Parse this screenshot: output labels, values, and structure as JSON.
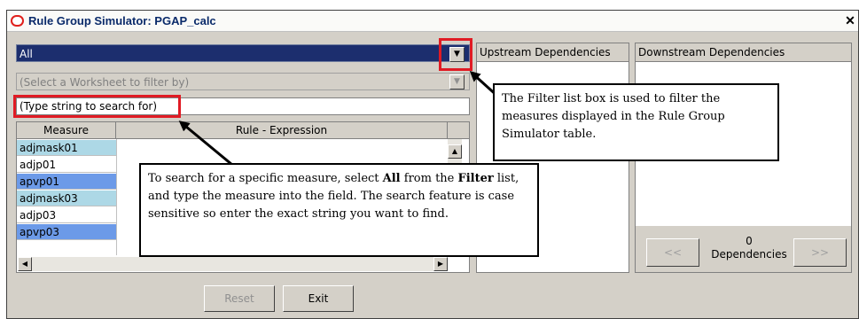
{
  "window": {
    "title": "Rule Group Simulator: PGAP_calc",
    "close_glyph": "✕"
  },
  "filter": {
    "value": "All",
    "dropdown_glyph": "▼"
  },
  "worksheet_filter": {
    "placeholder": "(Select a Worksheet to filter by)",
    "dropdown_glyph": "▼"
  },
  "search": {
    "placeholder": "(Type string to search for)"
  },
  "grid": {
    "columns": [
      "Measure",
      "Rule - Expression"
    ],
    "rows": [
      {
        "measure": "adjmask01",
        "color": "#add8e6"
      },
      {
        "measure": "adjp01",
        "color": "#ffffff"
      },
      {
        "measure": "apvp01",
        "color": "#6c9ae8"
      },
      {
        "measure": "adjmask03",
        "color": "#add8e6"
      },
      {
        "measure": "adjp03",
        "color": "#ffffff"
      },
      {
        "measure": "apvp03",
        "color": "#6c9ae8"
      }
    ],
    "scroll_up": "▲",
    "scroll_left": "◀",
    "scroll_right": "▶"
  },
  "upstream": {
    "header": "Upstream Dependencies"
  },
  "downstream": {
    "header": "Downstream Dependencies",
    "prev_label": "<<",
    "next_label": ">>",
    "count": "0",
    "count_label": "Dependencies"
  },
  "buttons": {
    "reset": "Reset",
    "exit": "Exit"
  },
  "callouts": {
    "filter_note": "The Filter list box is used to filter the measures displayed in the Rule Group Simulator table.",
    "search_note_1": "To search for a specific measure, select ",
    "search_note_all": "All",
    "search_note_2": " from the ",
    "search_note_filter": "Filter",
    "search_note_3": " list, and type the measure into the field. The search feature is case sensitive so enter the exact string you want to find."
  },
  "colors": {
    "highlight": "#e01b24",
    "selected": "#1c2e6e"
  }
}
